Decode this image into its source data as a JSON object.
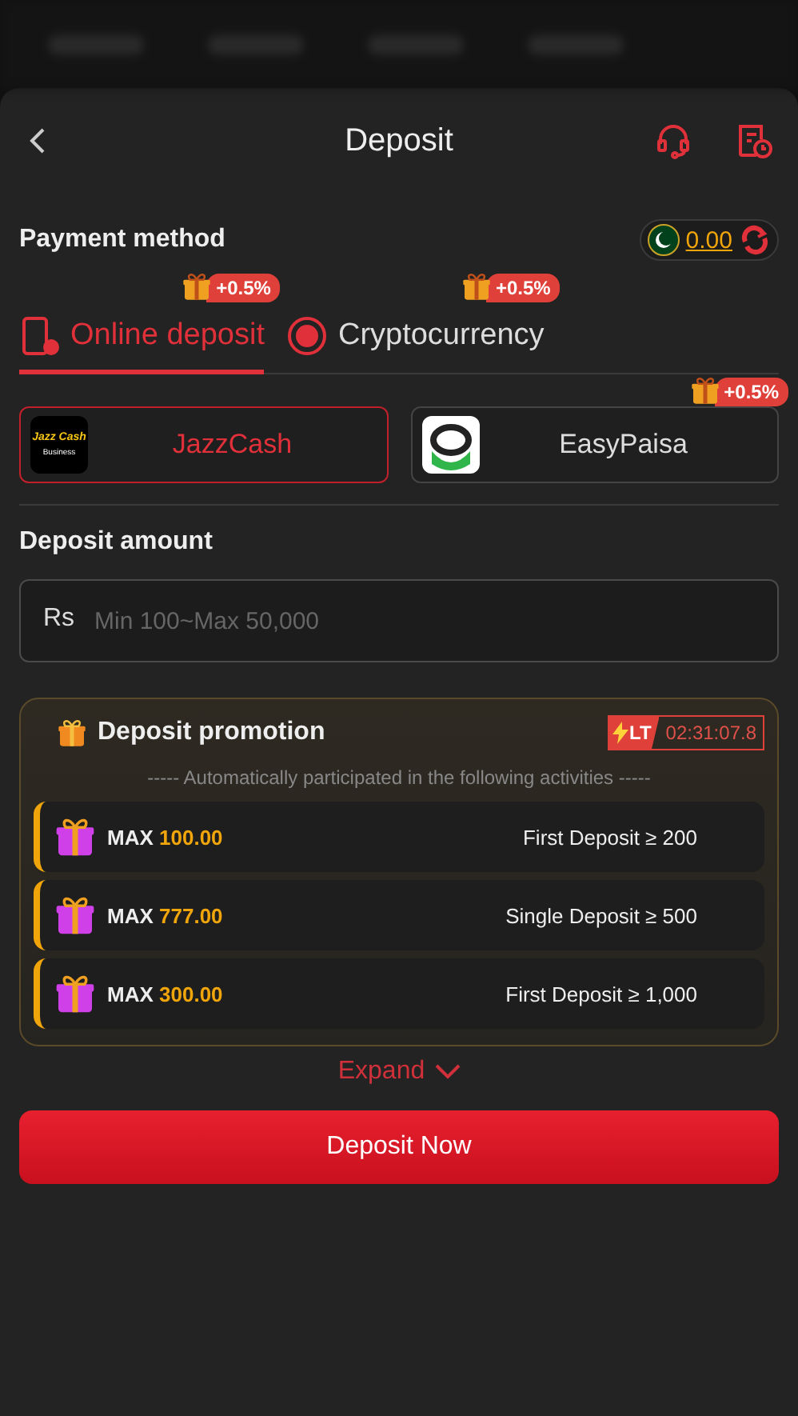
{
  "header": {
    "title": "Deposit"
  },
  "payment": {
    "label": "Payment method",
    "balance": "0.00"
  },
  "tabs": [
    {
      "label": "Online deposit",
      "bonus": "+0.5%",
      "kind": "phone",
      "selected": true
    },
    {
      "label": "Cryptocurrency",
      "bonus": "+0.5%",
      "kind": "crypto",
      "selected": false
    }
  ],
  "channels": [
    {
      "name": "JazzCash",
      "kind": "jazzcash",
      "logo_lines": [
        "Jazz Cash",
        "Business"
      ],
      "selected": true
    },
    {
      "name": "EasyPaisa",
      "kind": "easypaisa",
      "bonus": "+0.5%",
      "selected": false
    }
  ],
  "amount": {
    "label": "Deposit amount",
    "currency": "Rs",
    "placeholder": "Min 100~Max 50,000"
  },
  "promotion": {
    "title": "Deposit promotion",
    "badge": "LT",
    "countdown": "02:31:07.8",
    "subtitle": "----- Automatically participated in the following activities -----",
    "items": [
      {
        "prefix": "MAX",
        "amount": "100.00",
        "condition": "First Deposit ≥ 200"
      },
      {
        "prefix": "MAX",
        "amount": "777.00",
        "condition": "Single Deposit ≥ 500"
      },
      {
        "prefix": "MAX",
        "amount": "300.00",
        "condition": "First Deposit ≥ 1,000"
      }
    ]
  },
  "expand": "Expand",
  "submit": "Deposit Now"
}
